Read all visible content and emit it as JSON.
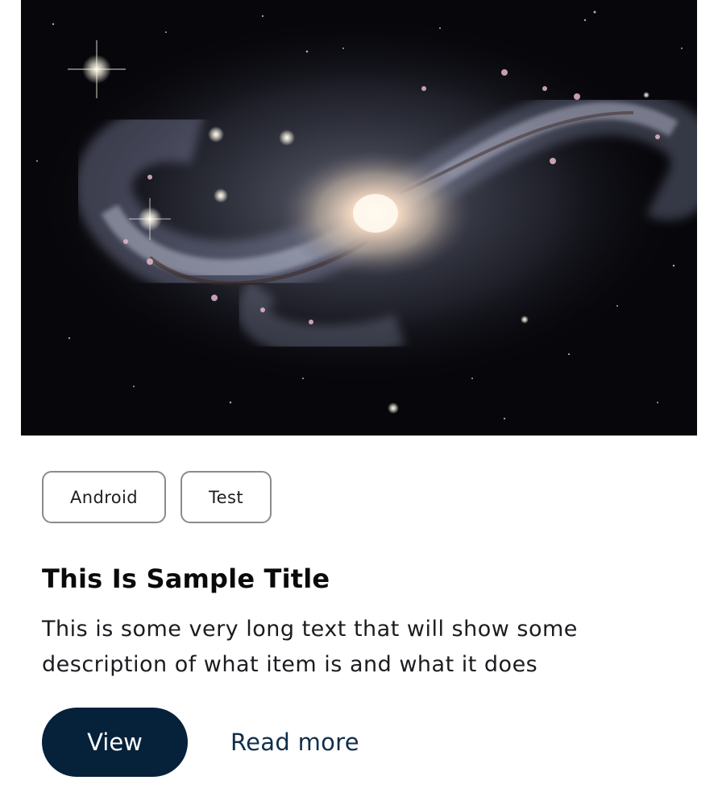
{
  "card": {
    "tags": [
      "Android",
      "Test"
    ],
    "title": "This Is Sample Title",
    "description": "This is some very long text that will show some description of what item is and what it does",
    "primary_action_label": "View",
    "secondary_action_label": "Read more"
  },
  "colors": {
    "primary_button_bg": "#06213a",
    "link_text": "#0f2f4a",
    "chip_border": "#8a8a90",
    "hero_bg": "#07070b"
  },
  "hero": {
    "subject": "spiral galaxy photograph",
    "icon": "galaxy-image"
  }
}
